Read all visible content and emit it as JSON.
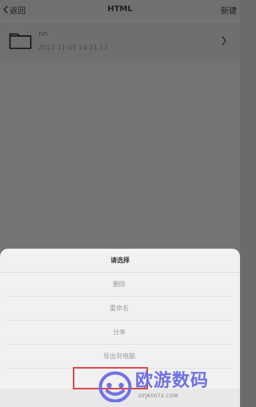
{
  "header": {
    "back_label": "返回",
    "title": "HTML",
    "new_label": "新建"
  },
  "folder": {
    "name": "nn",
    "date": "2022-11-05 14:31:13",
    "icon": "folder-icon"
  },
  "sheet": {
    "title": "请选择",
    "options": [
      "删除",
      "重命名",
      "分享",
      "导出到电脑"
    ]
  },
  "watermark": {
    "text": "欧游数码",
    "url": "OYJK0072.COM"
  },
  "colors": {
    "overlay": "#747474",
    "sheet_bg": "#f1f1f1",
    "highlight": "#d84a4a",
    "watermark": "#6e71e8"
  }
}
